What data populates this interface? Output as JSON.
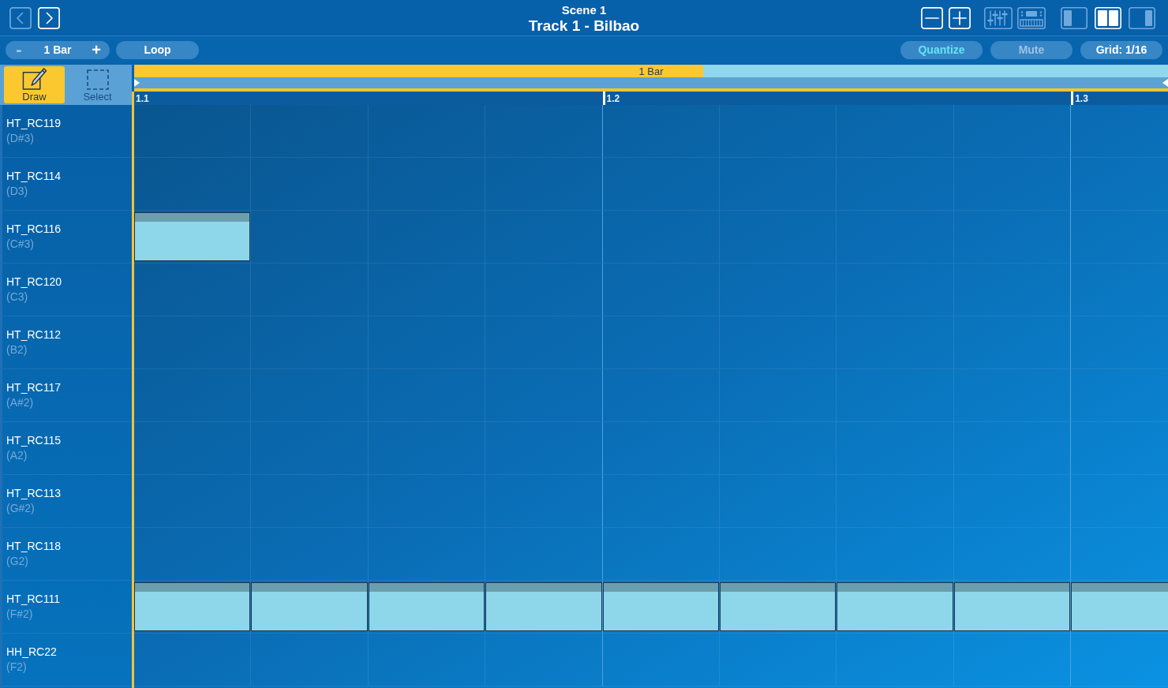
{
  "header": {
    "nav_buttons": [
      {
        "kind": "back",
        "disabled": true
      },
      {
        "kind": "forward",
        "disabled": false
      }
    ],
    "scene": "Scene 1",
    "track": "Track 1 - Bilbao",
    "zoom_buttons": [
      {
        "kind": "zoom_out"
      },
      {
        "kind": "zoom_in"
      }
    ],
    "view_toggles": [
      {
        "kind": "mixer",
        "on": false
      },
      {
        "kind": "keyboard",
        "on": false
      }
    ],
    "layout_buttons": [
      {
        "kind": "left",
        "selected": false
      },
      {
        "kind": "split",
        "selected": true
      },
      {
        "kind": "right",
        "selected": false
      }
    ]
  },
  "toolbar": {
    "length_stepper": {
      "decrement": {
        "label": "-",
        "disabled": true
      },
      "value": "1 Bar",
      "increment": {
        "label": "+",
        "disabled": false
      }
    },
    "loop_button": {
      "label": "Loop"
    },
    "right_buttons": [
      {
        "label": "Quantize",
        "on": true,
        "disabled": false
      },
      {
        "label": "Mute",
        "on": false,
        "disabled": true
      },
      {
        "label": "Grid: 1/16",
        "on": false,
        "disabled": false
      }
    ]
  },
  "tools": [
    {
      "kind": "draw",
      "label": "Draw",
      "selected": true
    },
    {
      "kind": "select",
      "label": "Select",
      "selected": false
    }
  ],
  "overview": {
    "label": "1 Bar",
    "level": 0.55
  },
  "ruler": [
    "1.1",
    "1.2",
    "1.3"
  ],
  "rows": [
    {
      "name": "HT_RC119",
      "pitch": "(D#3)",
      "steps": [
        false,
        false,
        false,
        false,
        false,
        false,
        false,
        false,
        false
      ]
    },
    {
      "name": "HT_RC114",
      "pitch": "(D3)",
      "steps": [
        false,
        false,
        false,
        false,
        false,
        false,
        false,
        false,
        false
      ]
    },
    {
      "name": "HT_RC116",
      "pitch": "(C#3)",
      "steps": [
        true,
        false,
        false,
        false,
        false,
        false,
        false,
        false,
        false
      ]
    },
    {
      "name": "HT_RC120",
      "pitch": "(C3)",
      "steps": [
        false,
        false,
        false,
        false,
        false,
        false,
        false,
        false,
        false
      ]
    },
    {
      "name": "HT_RC112",
      "pitch": "(B2)",
      "steps": [
        false,
        false,
        false,
        false,
        false,
        false,
        false,
        false,
        false
      ]
    },
    {
      "name": "HT_RC117",
      "pitch": "(A#2)",
      "steps": [
        false,
        false,
        false,
        false,
        false,
        false,
        false,
        false,
        false
      ]
    },
    {
      "name": "HT_RC115",
      "pitch": "(A2)",
      "steps": [
        false,
        false,
        false,
        false,
        false,
        false,
        false,
        false,
        false
      ]
    },
    {
      "name": "HT_RC113",
      "pitch": "(G#2)",
      "steps": [
        false,
        false,
        false,
        false,
        false,
        false,
        false,
        false,
        false
      ]
    },
    {
      "name": "HT_RC118",
      "pitch": "(G2)",
      "steps": [
        false,
        false,
        false,
        false,
        false,
        false,
        false,
        false,
        false
      ]
    },
    {
      "name": "HT_RC111",
      "pitch": "(F#2)",
      "steps": [
        true,
        true,
        true,
        true,
        true,
        true,
        true,
        true,
        true
      ]
    },
    {
      "name": "HH_RC22",
      "pitch": "(F2)",
      "steps": [
        false,
        false,
        false,
        false,
        false,
        false,
        false,
        false,
        false
      ]
    }
  ]
}
